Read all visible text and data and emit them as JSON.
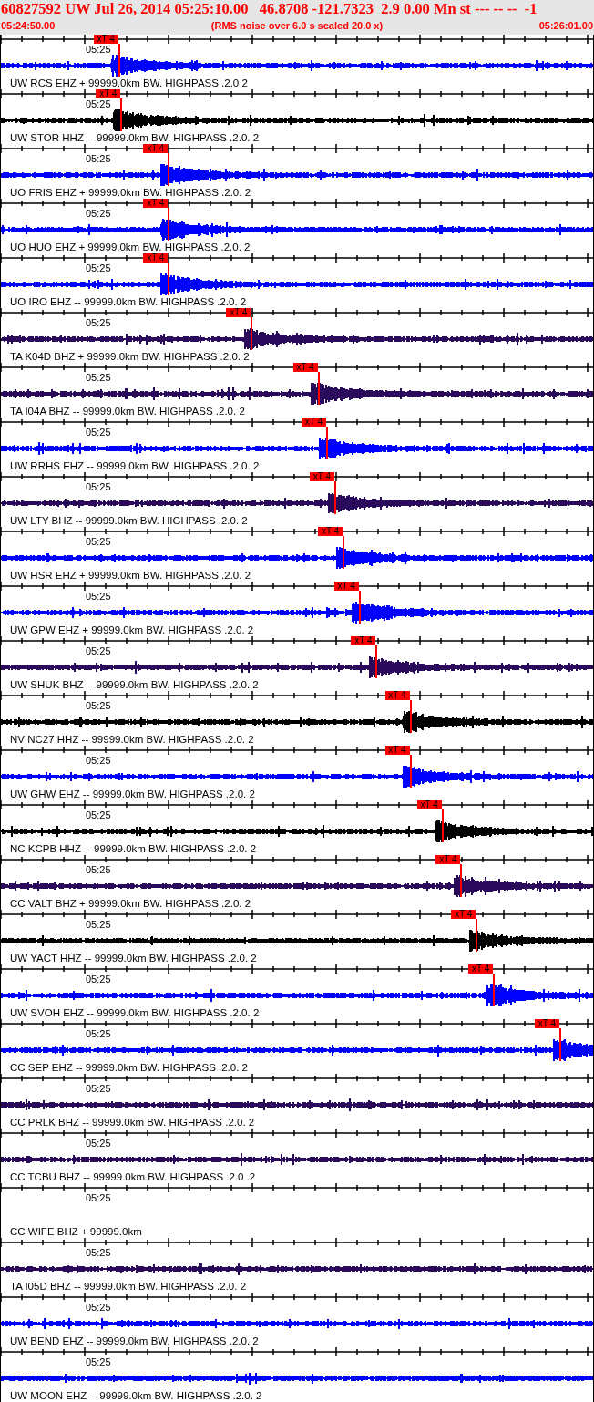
{
  "header": {
    "title": "60827592 UW Jul 26, 2014 05:25:10.00   46.8708 -121.7323  2.9 0.00 Mn st --- -- --  -1",
    "start_time": "05:24:50.00",
    "note": "(RMS noise over 6.0 s scaled 20.0 x)",
    "end_time": "05:26:01.00"
  },
  "traces": [
    {
      "station": "UW RCS EHZ + 99999.0km BW. HIGHPASS .2.0 2",
      "tick_label": "05:25",
      "color": "#0000ff",
      "pick": {
        "label": "xT 4"
      }
    },
    {
      "station": "UW STOR HHZ -- 99999.0km BW. HIGHPASS .2.0. 2",
      "tick_label": "05:25",
      "color": "#000000",
      "pick": {
        "label": "xT 4"
      }
    },
    {
      "station": "UO FRIS EHZ + 99999.0km BW. HIGHPASS .2.0. 2",
      "tick_label": "05:25",
      "color": "#0000ff",
      "pick": {
        "label": "xT 4"
      }
    },
    {
      "station": "UO HUO EHZ + 99999.0km BW. HIGHPASS .2.0. 2",
      "tick_label": "05:25",
      "color": "#0000ff",
      "pick": {
        "label": "xT 4"
      }
    },
    {
      "station": "UO IRO EHZ -- 99999.0km BW. HIGHPASS .2.0. 2",
      "tick_label": "05:25",
      "color": "#0000ff",
      "pick": {
        "label": "xT 4"
      }
    },
    {
      "station": "TA K04D BHZ + 99999.0km BW. HIGHPASS .2.0. 2",
      "tick_label": "05:25",
      "color": "#2a0a5a",
      "pick": {
        "label": "xT 4"
      }
    },
    {
      "station": "TA I04A BHZ -- 99999.0km BW. HIGHPASS .2.0. 2",
      "tick_label": "05:25",
      "color": "#2a0a5a",
      "pick": {
        "label": "xT 4"
      }
    },
    {
      "station": "UW RRHS EHZ -- 99999.0km BW. HIGHPASS .2.0. 2",
      "tick_label": "05:25",
      "color": "#0000ff",
      "pick": {
        "label": "xT 4"
      }
    },
    {
      "station": "UW LTY BHZ -- 99999.0km BW. HIGHPASS .2.0. 2",
      "tick_label": "05:25",
      "color": "#2a0a5a",
      "pick": {
        "label": "xT 4"
      }
    },
    {
      "station": "UW HSR EHZ + 99999.0km BW. HIGHPASS .2.0. 2",
      "tick_label": "05:25",
      "color": "#0000ff",
      "pick": {
        "label": "xT 4"
      }
    },
    {
      "station": "UW GPW EHZ + 99999.0km BW. HIGHPASS .2.0. 2",
      "tick_label": "05:25",
      "color": "#0000ff",
      "pick": {
        "label": "xT 4"
      }
    },
    {
      "station": "UW SHUK BHZ -- 99999.0km BW. HIGHPASS .2.0. 2",
      "tick_label": "05:25",
      "color": "#2a0a5a",
      "pick": {
        "label": "xT 4"
      }
    },
    {
      "station": "NV NC27 HHZ -- 99999.0km BW. HIGHPASS .2.0. 2",
      "tick_label": "05:25",
      "color": "#000000",
      "pick": {
        "label": "xT 4"
      }
    },
    {
      "station": "UW GHW EHZ -- 99999.0km BW. HIGHPASS .2.0. 2",
      "tick_label": "05:25",
      "color": "#0000ff",
      "pick": {
        "label": "xT 4"
      }
    },
    {
      "station": "NC KCPB HHZ -- 99999.0km BW. HIGHPASS .2.0. 2",
      "tick_label": "05:25",
      "color": "#000000",
      "pick": {
        "label": "xT 4"
      }
    },
    {
      "station": "CC VALT BHZ + 99999.0km BW. HIGHPASS .2.0. 2",
      "tick_label": "05:25",
      "color": "#2a0a5a",
      "pick": {
        "label": "xT 4"
      }
    },
    {
      "station": "UW YACT HHZ -- 99999.0km BW. HIGHPASS .2.0. 2",
      "tick_label": "05:25",
      "color": "#000000",
      "pick": {
        "label": "xT 4"
      }
    },
    {
      "station": "UW SVOH EHZ -- 99999.0km BW. HIGHPASS .2.0. 2",
      "tick_label": "05:25",
      "color": "#0000ff",
      "pick": {
        "label": "xT 4"
      }
    },
    {
      "station": "CC SEP EHZ -- 99999.0km BW. HIGHPASS .2.0. 2",
      "tick_label": "05:25",
      "color": "#0000ff",
      "pick": {
        "label": "xT 4"
      }
    },
    {
      "station": "CC PRLK BHZ -- 99999.0km BW. HIGHPASS .2.0. 2",
      "tick_label": "05:25",
      "color": "#2a0a5a"
    },
    {
      "station": "CC TCBU BHZ -- 99999.0km BW. HIGHPASS .2.0 .2",
      "tick_label": "05:25",
      "color": "#2a0a5a"
    },
    {
      "station": "CC WIFE BHZ + 99999.0km",
      "tick_label": "05:25"
    },
    {
      "station": "TA I05D BHZ -- 99999.0km BW. HIGHPASS .2.0. 2",
      "tick_label": "05:25",
      "color": "#2a0a5a"
    },
    {
      "station": "UW BEND EHZ -- 99999.0km BW. HIGHPASS .2.0. 2",
      "tick_label": "05:25",
      "color": "#0000ff"
    },
    {
      "station": "UW MOON EHZ -- 99999.0km BW. HIGHPASS .2.0. 2",
      "tick_label": "05:25",
      "color": "#0000ff"
    }
  ]
}
